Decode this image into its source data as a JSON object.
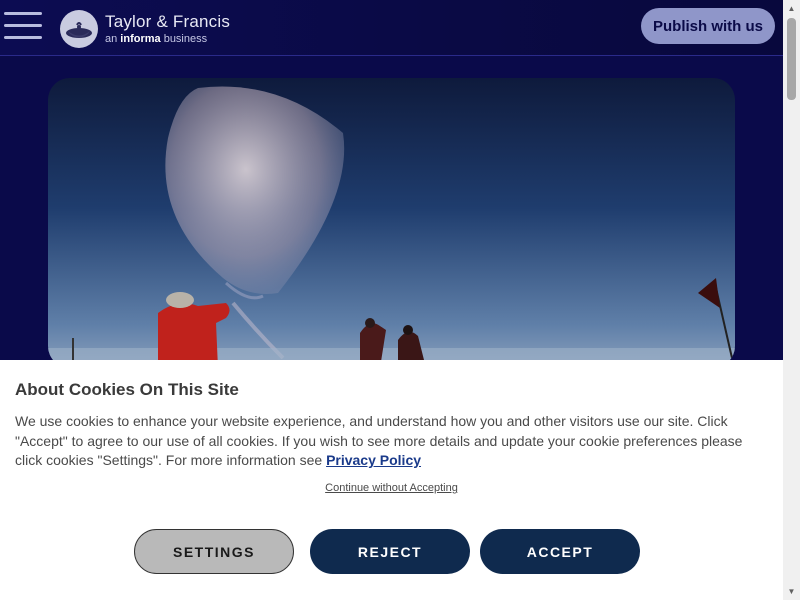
{
  "header": {
    "logo_title": "Taylor & Francis",
    "logo_sub_prefix": "an ",
    "logo_sub_bold": "informa",
    "logo_sub_suffix": " business",
    "publish_label": "Publish with us"
  },
  "cookie": {
    "title": "About Cookies On This Site",
    "body": "We use cookies to enhance your website experience, and understand how you and other visitors use our site. Click \"Accept\" to agree to our use of all cookies. If you wish to see more details and update your cookie preferences please click cookies \"Settings\". For more information see ",
    "privacy_link": "Privacy Policy",
    "continue_label": "Continue without Accepting",
    "settings_label": "SETTINGS",
    "reject_label": "REJECT",
    "accept_label": "ACCEPT"
  },
  "colors": {
    "header_bg": "#0c0c52",
    "publish_bg": "#8f96c9",
    "button_dark": "#0f2a4e",
    "button_gray": "#b9b9b9"
  },
  "icons": [
    "menu-icon",
    "logo-mark-icon",
    "scroll-up-icon",
    "scroll-down-icon"
  ]
}
